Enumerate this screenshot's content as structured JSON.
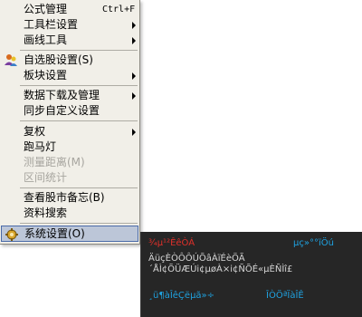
{
  "menu": {
    "items": [
      {
        "label": "公式管理",
        "shortcut": "Ctrl+F"
      },
      {
        "label": "工具栏设置"
      },
      {
        "label": "画线工具"
      },
      {
        "label": "自选股设置(S)"
      },
      {
        "label": "板块设置"
      },
      {
        "label": "数据下载及管理"
      },
      {
        "label": "同步自定义设置"
      },
      {
        "label": "复权"
      },
      {
        "label": "跑马灯"
      },
      {
        "label": "测量距离(M)"
      },
      {
        "label": "区间统计"
      },
      {
        "label": "查看股市备忘(B)"
      },
      {
        "label": "资料搜索"
      },
      {
        "label": "系统设置(O)"
      }
    ]
  },
  "panel": {
    "title": "¾µ¹²ÊêÒÁ",
    "version": "µç»°°ïÖú",
    "body": "ÄüçÈÒÔÔÚÕâÀïÉèÖÃ´ÅÌ¢ÕÜÆÚi¢µøÀ×i¢ÑÕÉ«µÈÑÌî£",
    "link1": "¸ü¶àÎêÇëµã»÷",
    "link2": "ÎÒÖªÏàÎÊ"
  },
  "colors": {
    "menu_bg": "#f1efe8",
    "selection": "#bcc6d8",
    "selection_border": "#4a6aa7",
    "panel_bg": "#262626",
    "panel_title": "#e0302a",
    "panel_link": "#1fa2e0"
  }
}
